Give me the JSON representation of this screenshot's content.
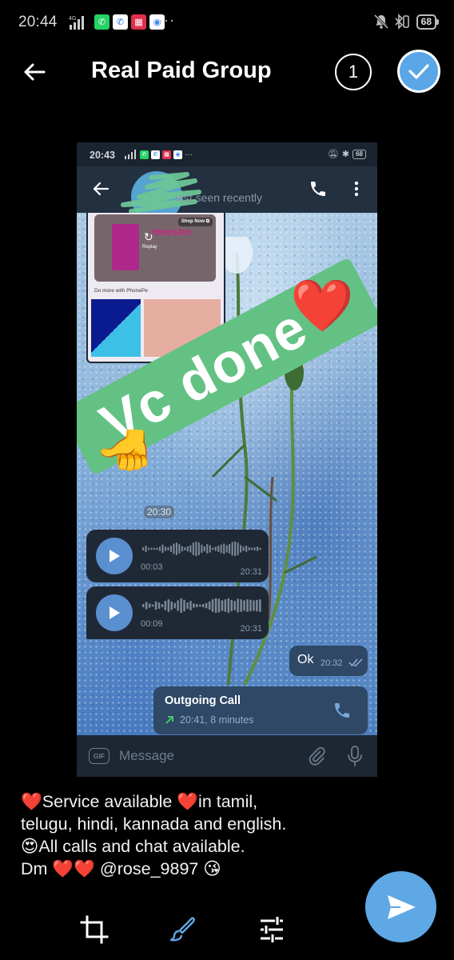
{
  "status_bar": {
    "time": "20:44",
    "network": "4G",
    "notification_apps": [
      {
        "name": "whatsapp",
        "color": "#25d366",
        "glyph": "✆"
      },
      {
        "name": "phone",
        "color": "#ffffff",
        "glyph": "✆"
      },
      {
        "name": "shopping-app",
        "color": "#e0304e",
        "glyph": "▦"
      },
      {
        "name": "google-pay",
        "color": "#ffffff",
        "glyph": "◉"
      }
    ],
    "more": "···",
    "battery": "68"
  },
  "header": {
    "title": "Real Paid Group",
    "selected_count": "1",
    "accent_color": "#5aa6e6"
  },
  "photo": {
    "status_bar": {
      "time": "20:43",
      "battery": "68"
    },
    "chat_header": {
      "subtitle": "last seen recently"
    },
    "ad": {
      "shop_now": "Shop Now ⧉",
      "brand": "meesho",
      "replay": "Replay",
      "section": "Do more with PhonePe"
    },
    "sticker": {
      "text": "Vc done",
      "heart": "❤️",
      "thumb": "👍"
    },
    "date_chip": "20:30",
    "voice_messages": [
      {
        "duration": "00:03",
        "time": "20:31"
      },
      {
        "duration": "00:09",
        "time": "20:31"
      }
    ],
    "outgoing_text": {
      "text": "Ok",
      "time": "20:32"
    },
    "call": {
      "title": "Outgoing Call",
      "detail": "20:41, 8 minutes"
    },
    "input": {
      "gif_label": "GIF",
      "placeholder": "Message"
    }
  },
  "caption": {
    "lines": [
      "❤️Service available ❤️in tamil,",
      "telugu, hindi, kannada and english.",
      "😍All calls and chat available.",
      "Dm ❤️❤️ @rose_9897  😘"
    ]
  },
  "toolbar": {
    "tools": [
      "crop",
      "paint",
      "adjust"
    ],
    "active_tool": "paint",
    "active_color": "#5fa8e6"
  },
  "send_button": {
    "color": "#5fa8e6"
  }
}
